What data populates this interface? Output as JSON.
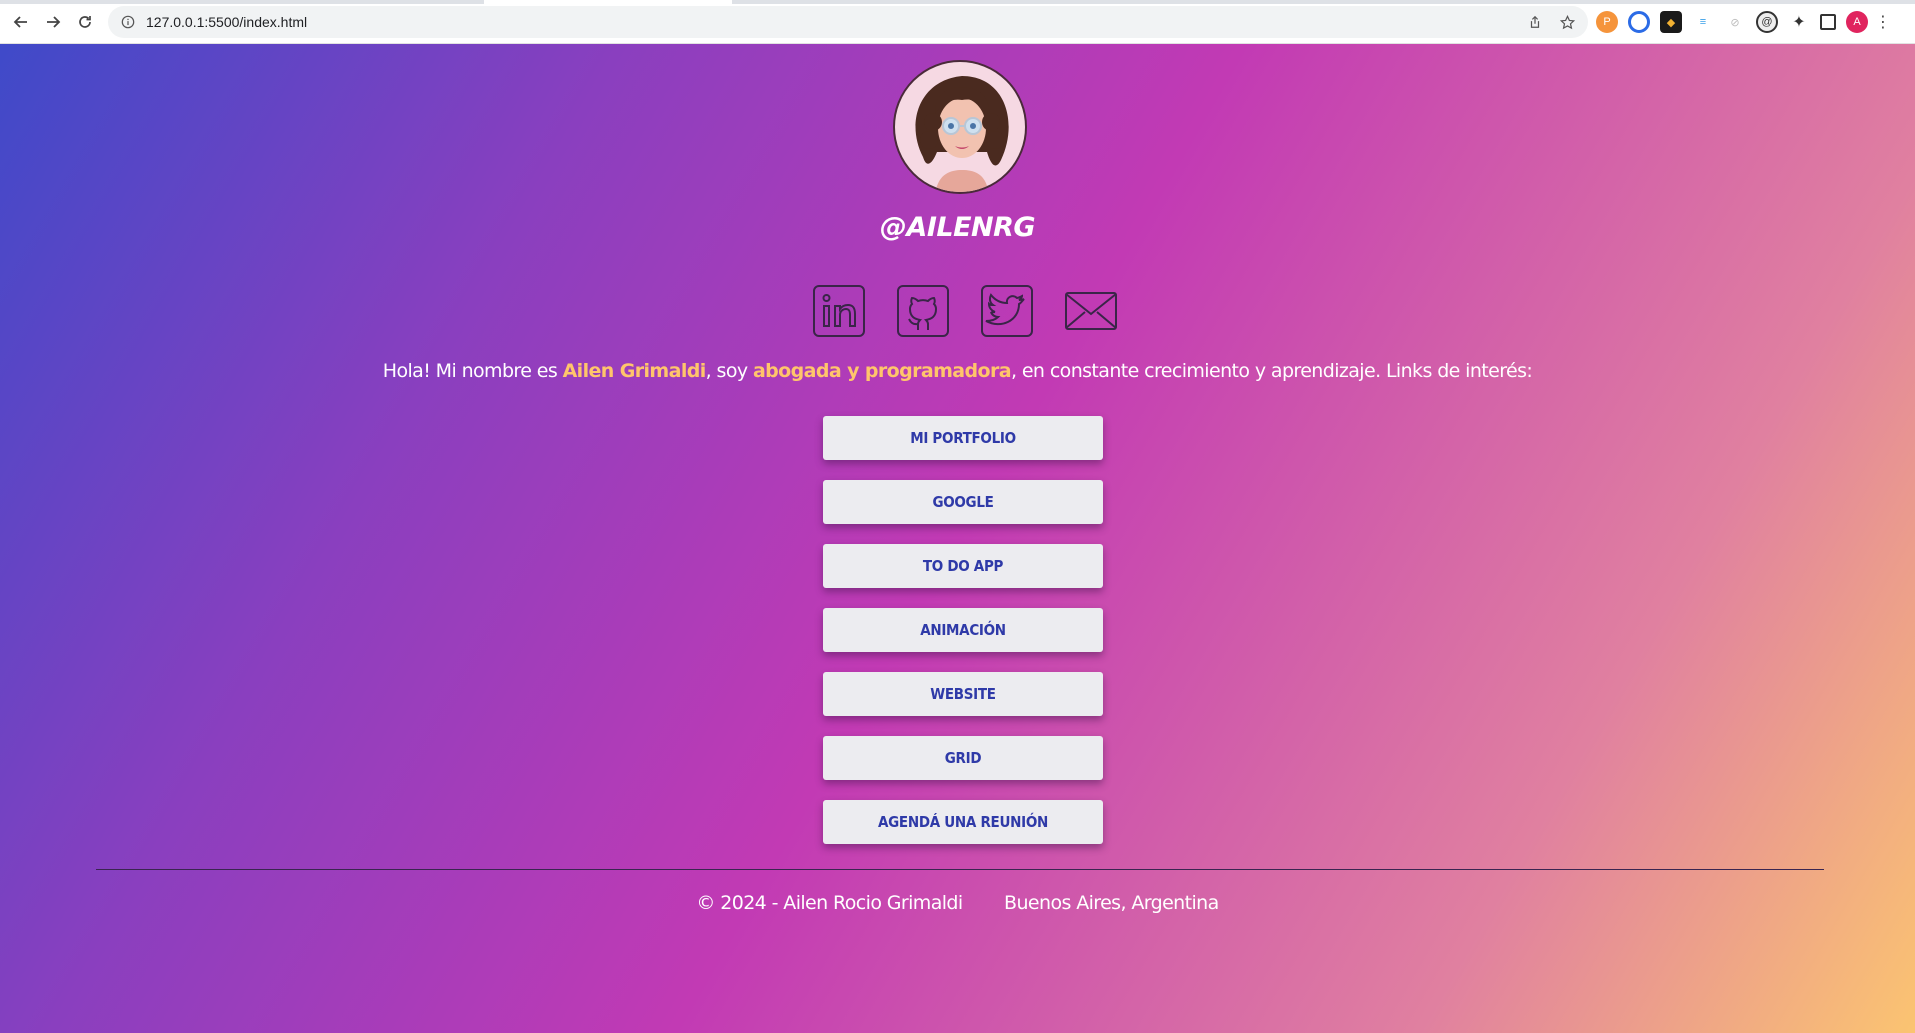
{
  "browser": {
    "url": "127.0.0.1:5500/index.html",
    "profile_initial": "A"
  },
  "profile": {
    "handle": "@AILENRG"
  },
  "socials": [
    {
      "name": "linkedin"
    },
    {
      "name": "github"
    },
    {
      "name": "twitter"
    },
    {
      "name": "email"
    }
  ],
  "intro": {
    "part1": "Hola! Mi nombre es ",
    "name": "Ailen Grimaldi",
    "part2": ", soy ",
    "role": "abogada y programadora",
    "part3": ", en constante crecimiento y aprendizaje. Links de interés:"
  },
  "links": [
    {
      "label": "MI PORTFOLIO"
    },
    {
      "label": "GOOGLE"
    },
    {
      "label": "TO DO APP"
    },
    {
      "label": "ANIMACIÓN"
    },
    {
      "label": "WEBSITE"
    },
    {
      "label": "GRID"
    },
    {
      "label": "AGENDÁ UNA REUNIÓN"
    }
  ],
  "footer": {
    "copyright": "© 2024 - Ailen Rocio Grimaldi",
    "location": "Buenos Aires, Argentina"
  },
  "colors": {
    "highlight": "#ffc56b",
    "button_text": "#2f3aa8",
    "button_bg": "#ececf0"
  }
}
